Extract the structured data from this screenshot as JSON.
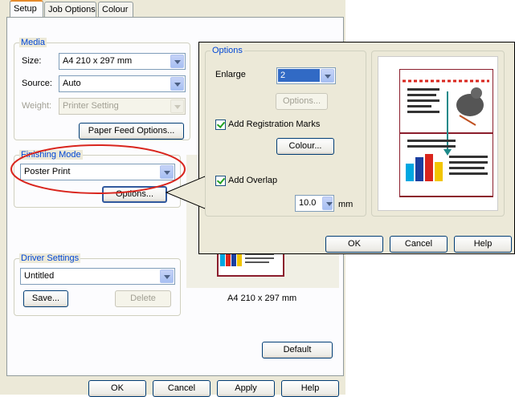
{
  "tabs": [
    "Setup",
    "Job Options",
    "Colour"
  ],
  "media": {
    "legend": "Media",
    "size_label": "Size:",
    "size_value": "A4 210 x 297 mm",
    "source_label": "Source:",
    "source_value": "Auto",
    "weight_label": "Weight:",
    "weight_value": "Printer Setting",
    "paper_feed_button": "Paper Feed Options..."
  },
  "finishing": {
    "legend": "Finishing Mode",
    "mode_value": "Poster Print",
    "options_button": "Options..."
  },
  "driver": {
    "legend": "Driver Settings",
    "value": "Untitled",
    "save_button": "Save...",
    "delete_button": "Delete"
  },
  "preview_caption": "A4 210 x 297 mm",
  "default_button": "Default",
  "bottom_buttons": {
    "ok": "OK",
    "cancel": "Cancel",
    "apply": "Apply",
    "help": "Help"
  },
  "options_dialog": {
    "legend": "Options",
    "enlarge_label": "Enlarge",
    "enlarge_value": "2",
    "options_button": "Options...",
    "registration_label": "Add Registration Marks",
    "colour_button": "Colour...",
    "overlap_label": "Add Overlap",
    "overlap_value": "10.0",
    "overlap_unit": "mm",
    "ok": "OK",
    "cancel": "Cancel",
    "help": "Help"
  },
  "colors": {
    "highlight_ellipse": "#d9251d",
    "legend_text": "#0046d5",
    "dialog_bg": "#ece9d8"
  }
}
